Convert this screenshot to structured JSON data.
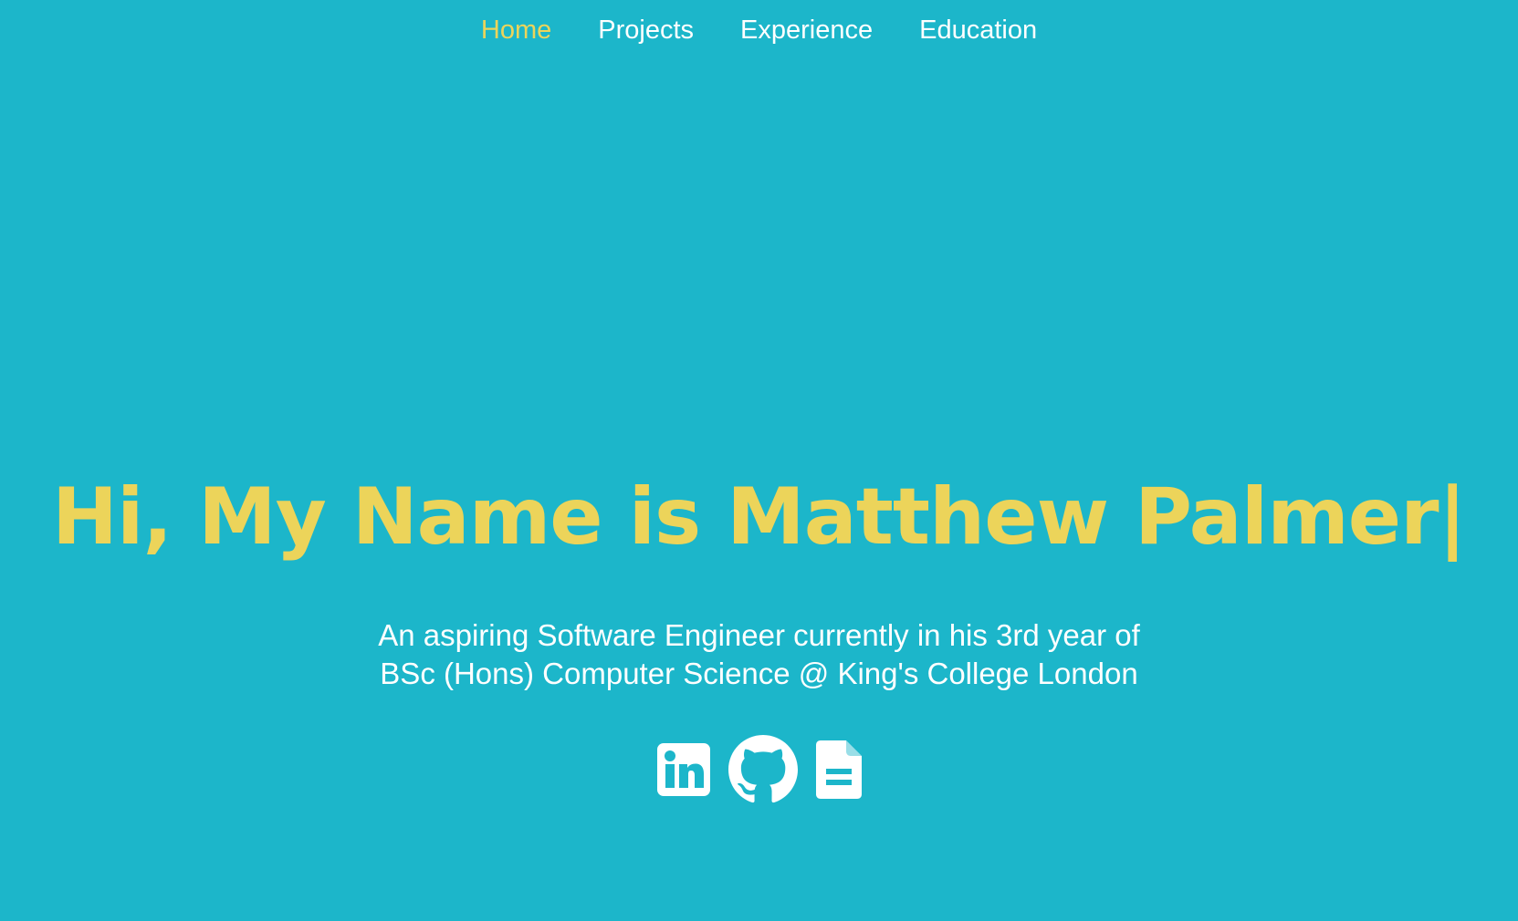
{
  "nav": {
    "items": [
      {
        "label": "Home",
        "active": true
      },
      {
        "label": "Projects",
        "active": false
      },
      {
        "label": "Experience",
        "active": false
      },
      {
        "label": "Education",
        "active": false
      }
    ]
  },
  "hero": {
    "title": "Hi, My Name is Matthew Palmer|",
    "subtitle_line1": "An aspiring Software Engineer currently in his 3rd year of",
    "subtitle_line2": "BSc (Hons) Computer Science @ King's College London"
  },
  "socials": [
    {
      "icon": "linkedin-icon"
    },
    {
      "icon": "github-icon"
    },
    {
      "icon": "document-icon"
    }
  ],
  "colors": {
    "background": "#1cb6ca",
    "accent": "#ecd45a",
    "text": "#ffffff"
  }
}
